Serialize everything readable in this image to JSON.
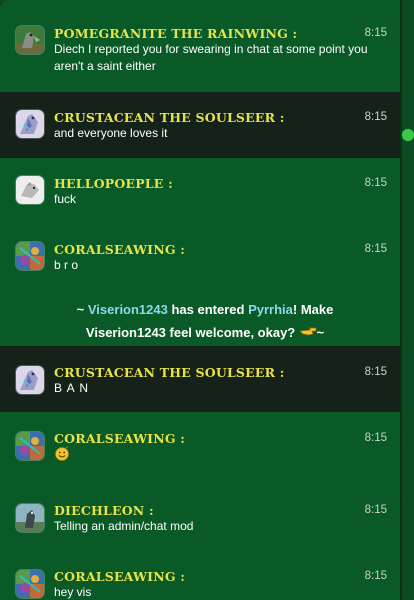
{
  "messages": [
    {
      "user": "POMEGRANITE THE RAINWING :",
      "time": "8:15",
      "text": "Diech I reported you for swearing in chat at some point you aren't a saint either",
      "avatar_icon": "rainwing-avatar-icon"
    },
    {
      "user": "CRUSTACEAN THE SOULSEER :",
      "time": "8:15",
      "text": "and everyone loves it",
      "avatar_icon": "soulseer-avatar-icon"
    },
    {
      "user": "HELLOPOEPLE :",
      "time": "8:15",
      "text": "fuck",
      "avatar_icon": "white-dragon-avatar-icon"
    },
    {
      "user": "CORALSEAWING :",
      "time": "8:15",
      "text": "b r o",
      "avatar_icon": "seawing-avatar-icon"
    },
    {
      "user": "CRUSTACEAN THE SOULSEER :",
      "time": "8:15",
      "text": "B A N",
      "avatar_icon": "soulseer-avatar-icon"
    },
    {
      "user": "CORALSEAWING :",
      "time": "8:15",
      "text": "",
      "emoji": "smiley-emoji-icon",
      "avatar_icon": "seawing-avatar-icon"
    },
    {
      "user": "DIECHLEON :",
      "time": "8:15",
      "text": "Telling an admin/chat mod",
      "avatar_icon": "grey-dragon-avatar-icon"
    },
    {
      "user": "CORALSEAWING :",
      "time": "8:15",
      "text": "hey vis",
      "avatar_icon": "seawing-avatar-icon"
    }
  ],
  "system": {
    "prefix": "~ ",
    "user": "Viserion1243",
    "mid": " has entered ",
    "room": "Pyrrhia",
    "after": "! Make Viserion1243 feel welcome, okay? ",
    "emoji": "pointing-hand-icon",
    "suffix": " ~"
  },
  "colors": {
    "username": "#e6e24a",
    "background": "#0a5a28",
    "highlight_row": "#14221a",
    "link_user": "#8fd8ea"
  }
}
